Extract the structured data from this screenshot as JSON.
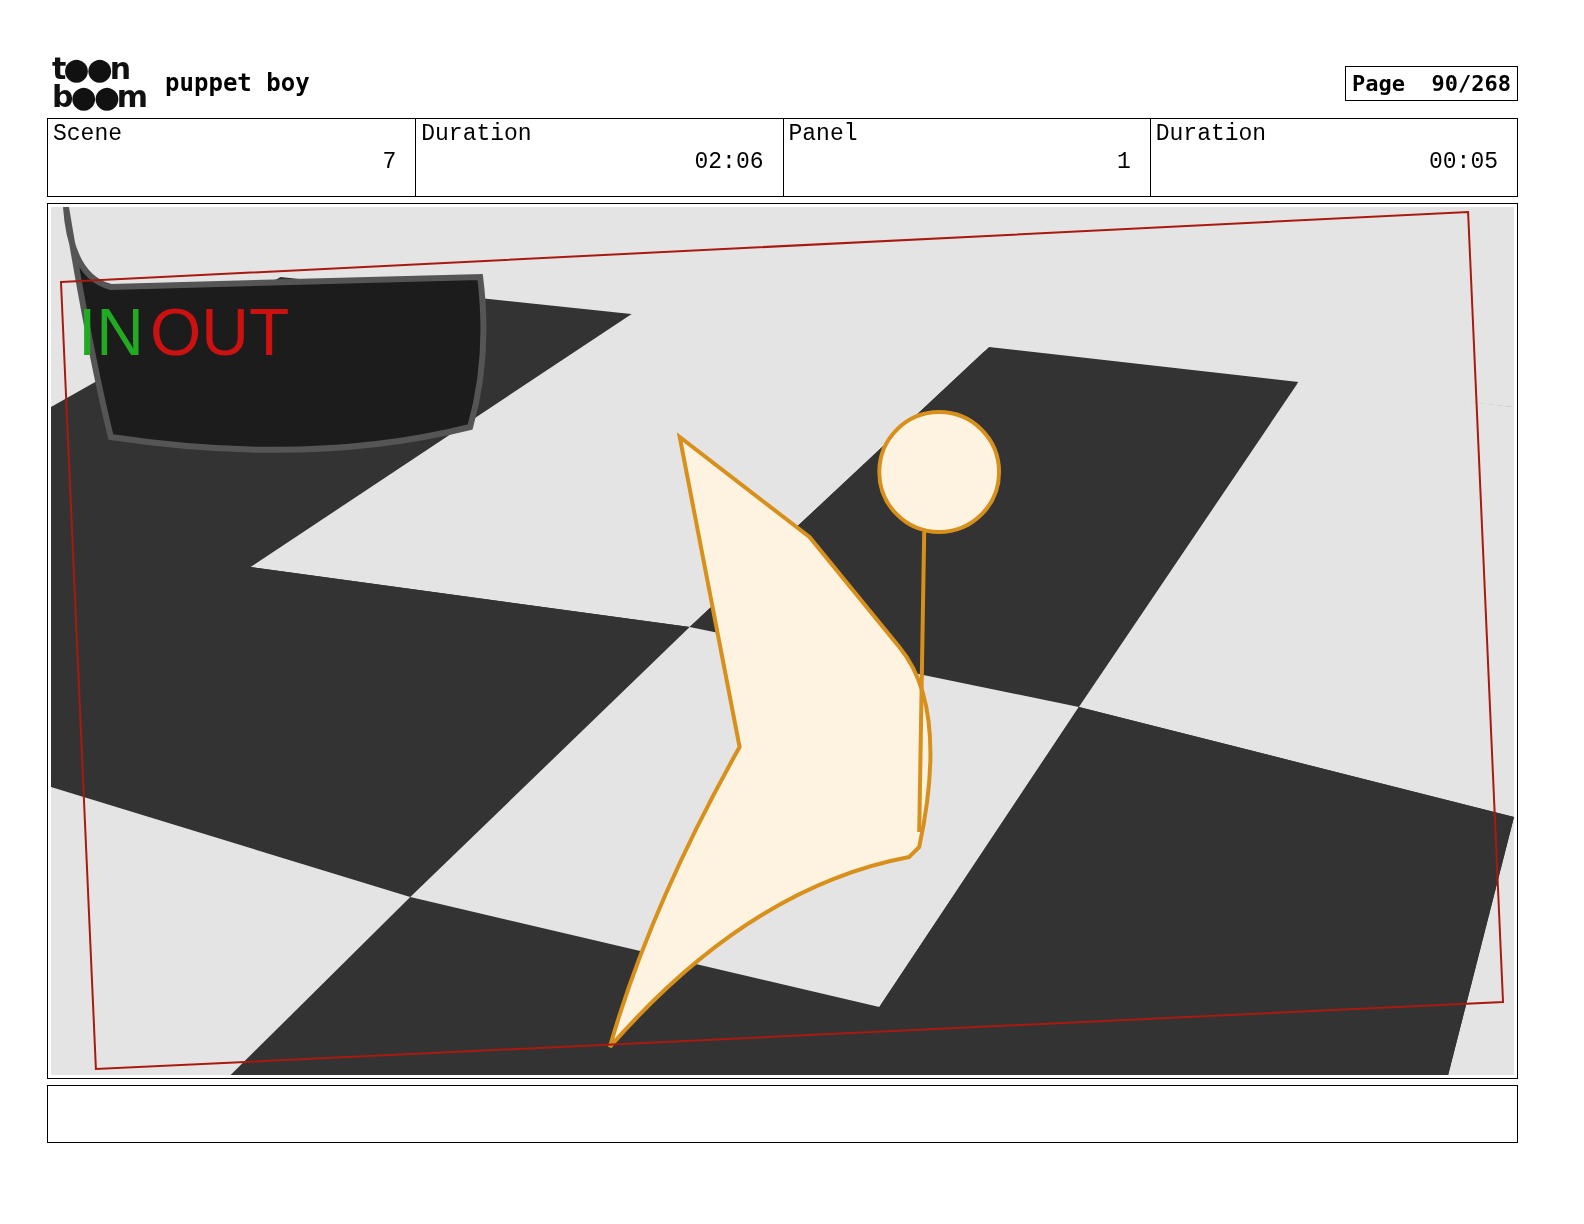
{
  "logo": {
    "top": "t●●n",
    "bottom": "b●●m"
  },
  "project": "puppet boy",
  "page": {
    "label": "Page",
    "value": "90/268"
  },
  "fields": [
    {
      "label": "Scene",
      "value": "7"
    },
    {
      "label": "Duration",
      "value": "02:06"
    },
    {
      "label": "Panel",
      "value": "1"
    },
    {
      "label": "Duration",
      "value": "00:05"
    }
  ],
  "panel": {
    "kind": "drawing",
    "marks": [
      {
        "text": "IN",
        "color": "#22aa22"
      },
      {
        "text": "OUT",
        "color": "#cc1111"
      }
    ]
  }
}
